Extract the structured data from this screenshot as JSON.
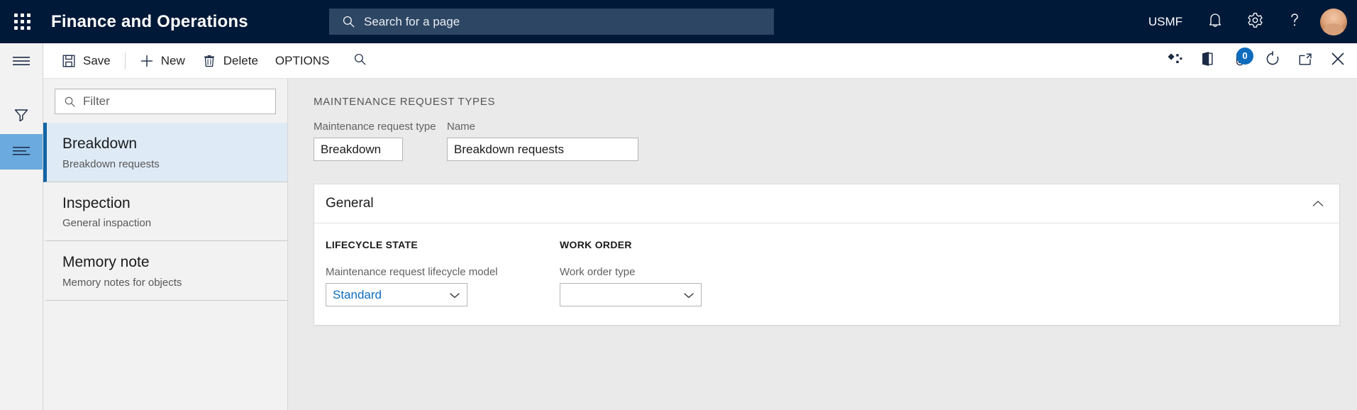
{
  "topnav": {
    "waffle_label": "App launcher",
    "app_title": "Finance and Operations",
    "search_placeholder": "Search for a page",
    "company": "USMF",
    "notifications_label": "Notifications",
    "settings_label": "Settings",
    "help_label": "Help",
    "avatar_label": "Account manager"
  },
  "commandbar": {
    "save_label": "Save",
    "new_label": "New",
    "delete_label": "Delete",
    "options_label": "OPTIONS",
    "search_label": "Search",
    "personalize_label": "Personalize",
    "office_label": "Open in Microsoft Office",
    "attachments_label": "Attachments",
    "attachments_count": "0",
    "refresh_label": "Refresh",
    "popout_label": "Open in new window",
    "close_label": "Close"
  },
  "rail": {
    "menu_label": "Show navigation pane",
    "filter_label": "Filter",
    "list_label": "List view"
  },
  "listpane": {
    "filter_placeholder": "Filter",
    "items": [
      {
        "title": "Breakdown",
        "subtitle": "Breakdown requests",
        "selected": true
      },
      {
        "title": "Inspection",
        "subtitle": "General inspaction",
        "selected": false
      },
      {
        "title": "Memory note",
        "subtitle": "Memory notes for objects",
        "selected": false
      }
    ]
  },
  "form": {
    "caption": "MAINTENANCE REQUEST TYPES",
    "fields": {
      "request_type_label": "Maintenance request type",
      "request_type_value": "Breakdown",
      "name_label": "Name",
      "name_value": "Breakdown requests"
    },
    "fasttab": {
      "title": "General",
      "collapse_icon": "chevron-up-icon",
      "lifecycle": {
        "group_title": "LIFECYCLE STATE",
        "field_label": "Maintenance request lifecycle model",
        "field_value": "Standard"
      },
      "workorder": {
        "group_title": "WORK ORDER",
        "field_label": "Work order type",
        "field_value": ""
      }
    }
  },
  "colors": {
    "nav_bg": "#001938",
    "accent": "#0f6cbd",
    "selected_row": "#deebf7",
    "selected_bar": "#1264a3",
    "rail_selected": "#6aaade"
  }
}
